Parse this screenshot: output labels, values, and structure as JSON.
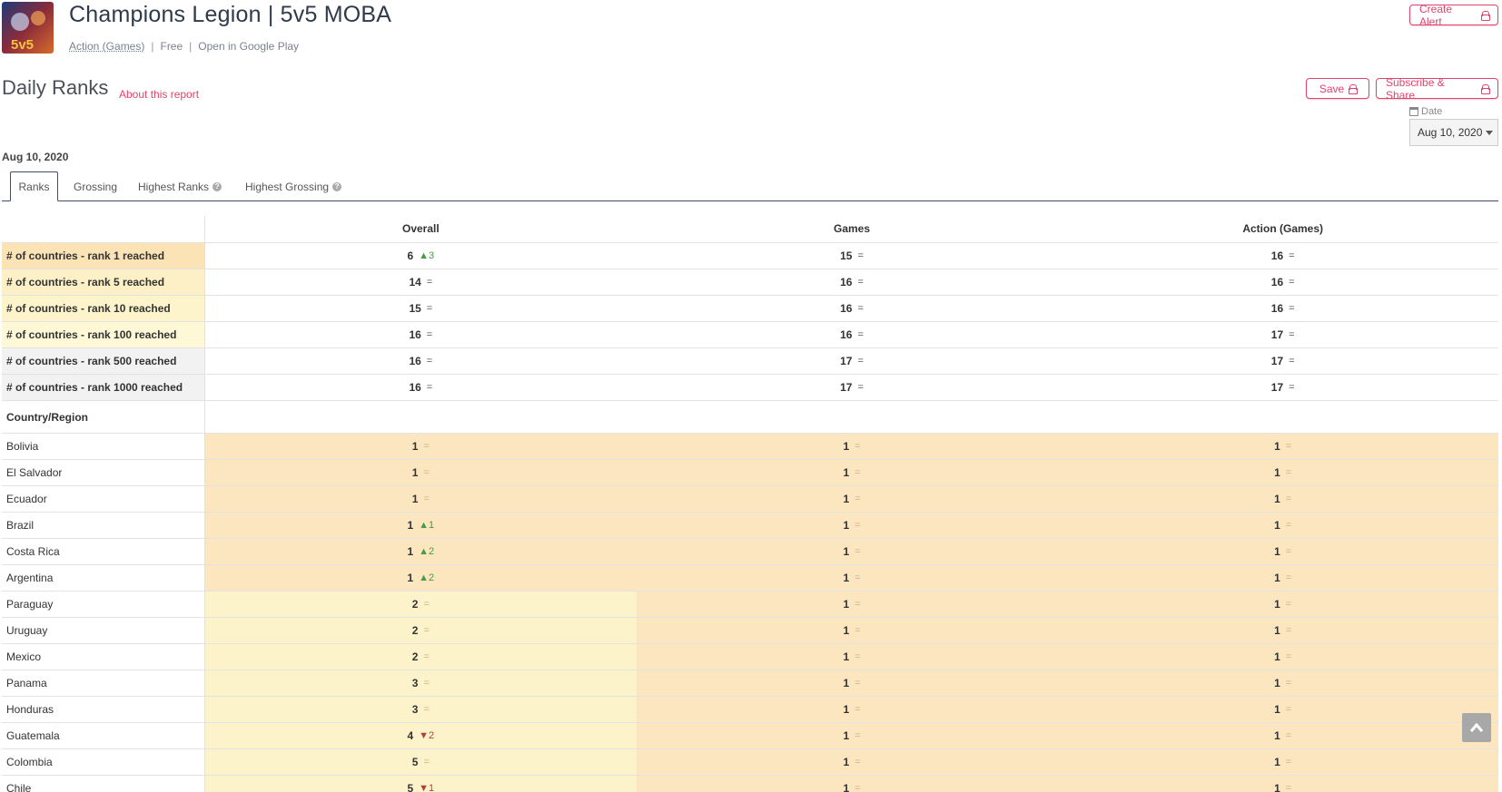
{
  "app": {
    "title": "Champions Legion | 5v5 MOBA",
    "category": "Action (Games)",
    "price": "Free",
    "store_link": "Open in Google Play",
    "icon_text": "5v5"
  },
  "buttons": {
    "create_alert": "Create Alert",
    "save": "Save",
    "subscribe_share": "Subscribe & Share"
  },
  "report": {
    "title": "Daily Ranks",
    "about": "About this report",
    "date_heading": "Aug 10, 2020"
  },
  "date_filter": {
    "label": "Date",
    "value": "Aug 10, 2020"
  },
  "tabs": [
    "Ranks",
    "Grossing",
    "Highest Ranks",
    "Highest Grossing"
  ],
  "columns": [
    "Overall",
    "Games",
    "Action (Games)"
  ],
  "summary": [
    {
      "label": "# of countries - rank 1 reached",
      "cells": [
        [
          "6",
          "▲3"
        ],
        [
          "15",
          "="
        ],
        [
          "16",
          "="
        ]
      ]
    },
    {
      "label": "# of countries - rank 5 reached",
      "cells": [
        [
          "14",
          "="
        ],
        [
          "16",
          "="
        ],
        [
          "16",
          "="
        ]
      ]
    },
    {
      "label": "# of countries - rank 10 reached",
      "cells": [
        [
          "15",
          "="
        ],
        [
          "16",
          "="
        ],
        [
          "16",
          "="
        ]
      ]
    },
    {
      "label": "# of countries - rank 100 reached",
      "cells": [
        [
          "16",
          "="
        ],
        [
          "16",
          "="
        ],
        [
          "17",
          "="
        ]
      ]
    },
    {
      "label": "# of countries - rank 500 reached",
      "cells": [
        [
          "16",
          "="
        ],
        [
          "17",
          "="
        ],
        [
          "17",
          "="
        ]
      ]
    },
    {
      "label": "# of countries - rank 1000 reached",
      "cells": [
        [
          "16",
          "="
        ],
        [
          "17",
          "="
        ],
        [
          "17",
          "="
        ]
      ]
    }
  ],
  "country_header": "Country/Region",
  "countries": [
    {
      "name": "Bolivia",
      "cells": [
        [
          "1",
          "="
        ],
        [
          "1",
          "="
        ],
        [
          "1",
          "="
        ]
      ]
    },
    {
      "name": "El Salvador",
      "cells": [
        [
          "1",
          "="
        ],
        [
          "1",
          "="
        ],
        [
          "1",
          "="
        ]
      ]
    },
    {
      "name": "Ecuador",
      "cells": [
        [
          "1",
          "="
        ],
        [
          "1",
          "="
        ],
        [
          "1",
          "="
        ]
      ]
    },
    {
      "name": "Brazil",
      "cells": [
        [
          "1",
          "▲1"
        ],
        [
          "1",
          "="
        ],
        [
          "1",
          "="
        ]
      ]
    },
    {
      "name": "Costa Rica",
      "cells": [
        [
          "1",
          "▲2"
        ],
        [
          "1",
          "="
        ],
        [
          "1",
          "="
        ]
      ]
    },
    {
      "name": "Argentina",
      "cells": [
        [
          "1",
          "▲2"
        ],
        [
          "1",
          "="
        ],
        [
          "1",
          "="
        ]
      ]
    },
    {
      "name": "Paraguay",
      "cells": [
        [
          "2",
          "="
        ],
        [
          "1",
          "="
        ],
        [
          "1",
          "="
        ]
      ]
    },
    {
      "name": "Uruguay",
      "cells": [
        [
          "2",
          "="
        ],
        [
          "1",
          "="
        ],
        [
          "1",
          "="
        ]
      ]
    },
    {
      "name": "Mexico",
      "cells": [
        [
          "2",
          "="
        ],
        [
          "1",
          "="
        ],
        [
          "1",
          "="
        ]
      ]
    },
    {
      "name": "Panama",
      "cells": [
        [
          "3",
          "="
        ],
        [
          "1",
          "="
        ],
        [
          "1",
          "="
        ]
      ]
    },
    {
      "name": "Honduras",
      "cells": [
        [
          "3",
          "="
        ],
        [
          "1",
          "="
        ],
        [
          "1",
          "="
        ]
      ]
    },
    {
      "name": "Guatemala",
      "cells": [
        [
          "4",
          "▼2"
        ],
        [
          "1",
          "="
        ],
        [
          "1",
          "="
        ]
      ]
    },
    {
      "name": "Colombia",
      "cells": [
        [
          "5",
          "="
        ],
        [
          "1",
          "="
        ],
        [
          "1",
          "="
        ]
      ]
    },
    {
      "name": "Chile",
      "cells": [
        [
          "5",
          "▼1"
        ],
        [
          "1",
          "="
        ],
        [
          "1",
          "="
        ]
      ]
    }
  ]
}
